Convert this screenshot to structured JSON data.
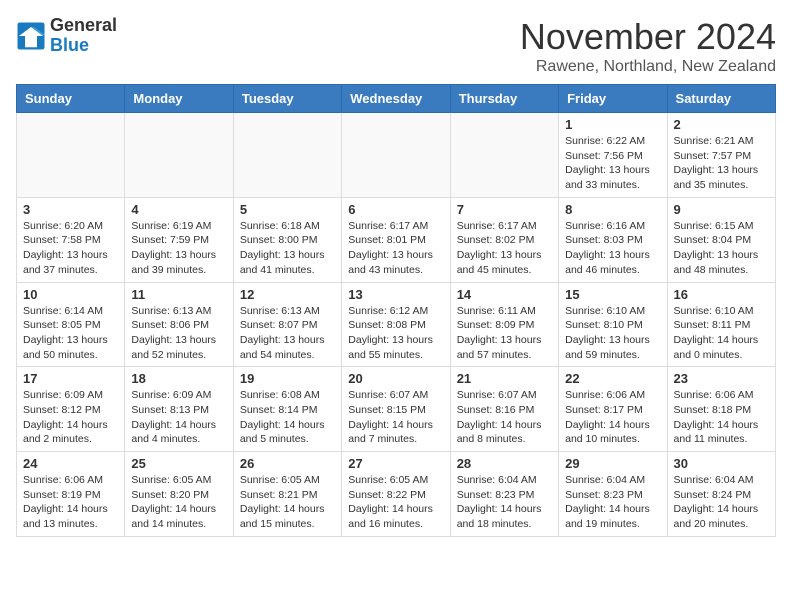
{
  "header": {
    "logo_general": "General",
    "logo_blue": "Blue",
    "month_title": "November 2024",
    "location": "Rawene, Northland, New Zealand"
  },
  "days_of_week": [
    "Sunday",
    "Monday",
    "Tuesday",
    "Wednesday",
    "Thursday",
    "Friday",
    "Saturday"
  ],
  "weeks": [
    [
      {
        "day": "",
        "info": ""
      },
      {
        "day": "",
        "info": ""
      },
      {
        "day": "",
        "info": ""
      },
      {
        "day": "",
        "info": ""
      },
      {
        "day": "",
        "info": ""
      },
      {
        "day": "1",
        "info": "Sunrise: 6:22 AM\nSunset: 7:56 PM\nDaylight: 13 hours\nand 33 minutes."
      },
      {
        "day": "2",
        "info": "Sunrise: 6:21 AM\nSunset: 7:57 PM\nDaylight: 13 hours\nand 35 minutes."
      }
    ],
    [
      {
        "day": "3",
        "info": "Sunrise: 6:20 AM\nSunset: 7:58 PM\nDaylight: 13 hours\nand 37 minutes."
      },
      {
        "day": "4",
        "info": "Sunrise: 6:19 AM\nSunset: 7:59 PM\nDaylight: 13 hours\nand 39 minutes."
      },
      {
        "day": "5",
        "info": "Sunrise: 6:18 AM\nSunset: 8:00 PM\nDaylight: 13 hours\nand 41 minutes."
      },
      {
        "day": "6",
        "info": "Sunrise: 6:17 AM\nSunset: 8:01 PM\nDaylight: 13 hours\nand 43 minutes."
      },
      {
        "day": "7",
        "info": "Sunrise: 6:17 AM\nSunset: 8:02 PM\nDaylight: 13 hours\nand 45 minutes."
      },
      {
        "day": "8",
        "info": "Sunrise: 6:16 AM\nSunset: 8:03 PM\nDaylight: 13 hours\nand 46 minutes."
      },
      {
        "day": "9",
        "info": "Sunrise: 6:15 AM\nSunset: 8:04 PM\nDaylight: 13 hours\nand 48 minutes."
      }
    ],
    [
      {
        "day": "10",
        "info": "Sunrise: 6:14 AM\nSunset: 8:05 PM\nDaylight: 13 hours\nand 50 minutes."
      },
      {
        "day": "11",
        "info": "Sunrise: 6:13 AM\nSunset: 8:06 PM\nDaylight: 13 hours\nand 52 minutes."
      },
      {
        "day": "12",
        "info": "Sunrise: 6:13 AM\nSunset: 8:07 PM\nDaylight: 13 hours\nand 54 minutes."
      },
      {
        "day": "13",
        "info": "Sunrise: 6:12 AM\nSunset: 8:08 PM\nDaylight: 13 hours\nand 55 minutes."
      },
      {
        "day": "14",
        "info": "Sunrise: 6:11 AM\nSunset: 8:09 PM\nDaylight: 13 hours\nand 57 minutes."
      },
      {
        "day": "15",
        "info": "Sunrise: 6:10 AM\nSunset: 8:10 PM\nDaylight: 13 hours\nand 59 minutes."
      },
      {
        "day": "16",
        "info": "Sunrise: 6:10 AM\nSunset: 8:11 PM\nDaylight: 14 hours\nand 0 minutes."
      }
    ],
    [
      {
        "day": "17",
        "info": "Sunrise: 6:09 AM\nSunset: 8:12 PM\nDaylight: 14 hours\nand 2 minutes."
      },
      {
        "day": "18",
        "info": "Sunrise: 6:09 AM\nSunset: 8:13 PM\nDaylight: 14 hours\nand 4 minutes."
      },
      {
        "day": "19",
        "info": "Sunrise: 6:08 AM\nSunset: 8:14 PM\nDaylight: 14 hours\nand 5 minutes."
      },
      {
        "day": "20",
        "info": "Sunrise: 6:07 AM\nSunset: 8:15 PM\nDaylight: 14 hours\nand 7 minutes."
      },
      {
        "day": "21",
        "info": "Sunrise: 6:07 AM\nSunset: 8:16 PM\nDaylight: 14 hours\nand 8 minutes."
      },
      {
        "day": "22",
        "info": "Sunrise: 6:06 AM\nSunset: 8:17 PM\nDaylight: 14 hours\nand 10 minutes."
      },
      {
        "day": "23",
        "info": "Sunrise: 6:06 AM\nSunset: 8:18 PM\nDaylight: 14 hours\nand 11 minutes."
      }
    ],
    [
      {
        "day": "24",
        "info": "Sunrise: 6:06 AM\nSunset: 8:19 PM\nDaylight: 14 hours\nand 13 minutes."
      },
      {
        "day": "25",
        "info": "Sunrise: 6:05 AM\nSunset: 8:20 PM\nDaylight: 14 hours\nand 14 minutes."
      },
      {
        "day": "26",
        "info": "Sunrise: 6:05 AM\nSunset: 8:21 PM\nDaylight: 14 hours\nand 15 minutes."
      },
      {
        "day": "27",
        "info": "Sunrise: 6:05 AM\nSunset: 8:22 PM\nDaylight: 14 hours\nand 16 minutes."
      },
      {
        "day": "28",
        "info": "Sunrise: 6:04 AM\nSunset: 8:23 PM\nDaylight: 14 hours\nand 18 minutes."
      },
      {
        "day": "29",
        "info": "Sunrise: 6:04 AM\nSunset: 8:23 PM\nDaylight: 14 hours\nand 19 minutes."
      },
      {
        "day": "30",
        "info": "Sunrise: 6:04 AM\nSunset: 8:24 PM\nDaylight: 14 hours\nand 20 minutes."
      }
    ]
  ]
}
